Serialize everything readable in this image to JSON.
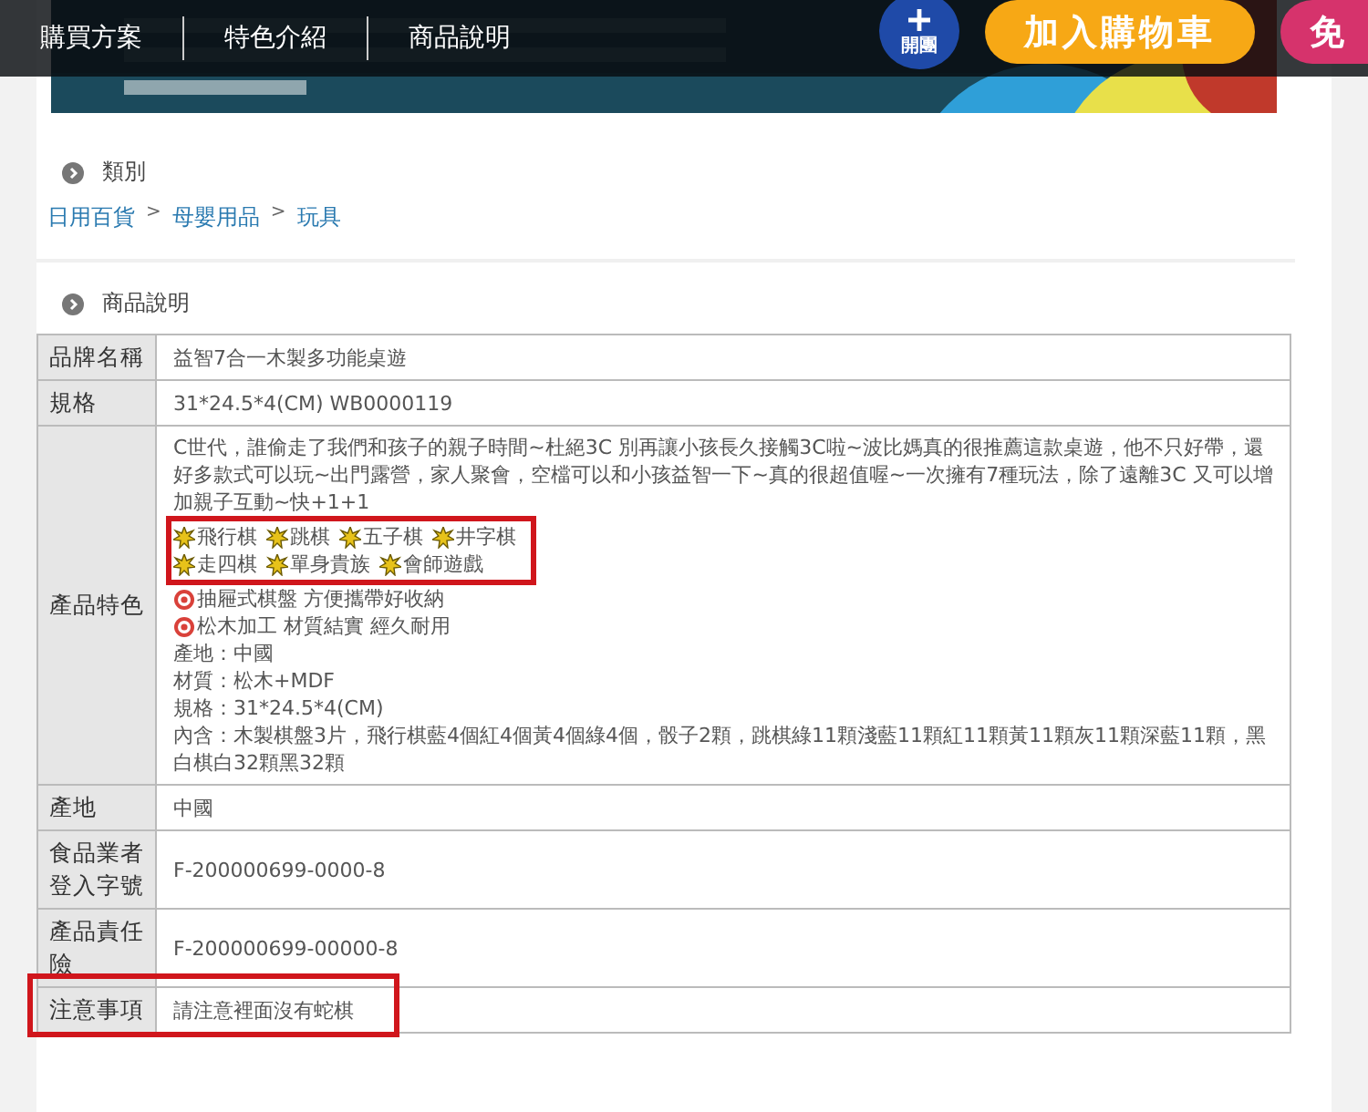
{
  "nav": {
    "tabs": [
      {
        "label": "購買方案",
        "selected": false
      },
      {
        "label": "特色介紹",
        "selected": false
      },
      {
        "label": "商品說明",
        "selected": false
      }
    ]
  },
  "actions": [
    {
      "kind": "group",
      "label": "開團"
    },
    {
      "kind": "cart",
      "label": "加入購物車"
    },
    {
      "kind": "shipping",
      "label": "免"
    }
  ],
  "category": {
    "title": "類別",
    "breadcrumb": [
      {
        "label": "日用百貨",
        "separator": ">"
      },
      {
        "label": "母嬰用品",
        "separator": ">"
      },
      {
        "label": "玩具"
      }
    ]
  },
  "description": {
    "title": "商品說明",
    "rows": [
      {
        "kind": "text",
        "label": "品牌名稱",
        "value": "益智7合一木製多功能桌遊",
        "highlighted": false
      },
      {
        "kind": "text",
        "label": "規格",
        "value": "31*24.5*4(CM) WB0000119",
        "highlighted": false
      },
      {
        "kind": "features",
        "label": "產品特色",
        "highlighted": false,
        "intro": "C世代，誰偷走了我們和孩子的親子時間~杜絕3C 別再讓小孩長久接觸3C啦~波比媽真的很推薦這款桌遊，他不只好帶，還好多款式可以玩~出門露營，家人聚會，空檔可以和小孩益智一下~真的很超值喔~一次擁有7種玩法，除了遠離3C  又可以增加親子互動~快+1+1",
        "games": {
          "highlighted": true,
          "lines": [
            [
              "飛行棋",
              "跳棋",
              "五子棋",
              "井字棋"
            ],
            [
              "走四棋",
              "單身貴族",
              "會師遊戲"
            ]
          ]
        },
        "points": [
          "抽屜式棋盤 方便攜帶好收納",
          "松木加工 材質結實 經久耐用"
        ],
        "details": [
          "產地：中國",
          "材質：松木+MDF",
          "規格：31*24.5*4(CM)",
          "內含：木製棋盤3片，飛行棋藍4個紅4個黃4個綠4個，骰子2顆，跳棋綠11顆淺藍11顆紅11顆黃11顆灰11顆深藍11顆，黑白棋白32顆黑32顆"
        ]
      },
      {
        "kind": "text",
        "label": "產地",
        "value": "中國",
        "highlighted": false
      },
      {
        "kind": "text",
        "label": "食品業者登入字號",
        "value": "F-200000699-0000-8",
        "highlighted": false
      },
      {
        "kind": "text",
        "label": "產品責任險",
        "value": "F-200000699-00000-8",
        "highlighted": false
      },
      {
        "kind": "text",
        "label": "注意事項",
        "value": "請注意裡面沒有蛇棋",
        "highlighted": true
      }
    ]
  }
}
